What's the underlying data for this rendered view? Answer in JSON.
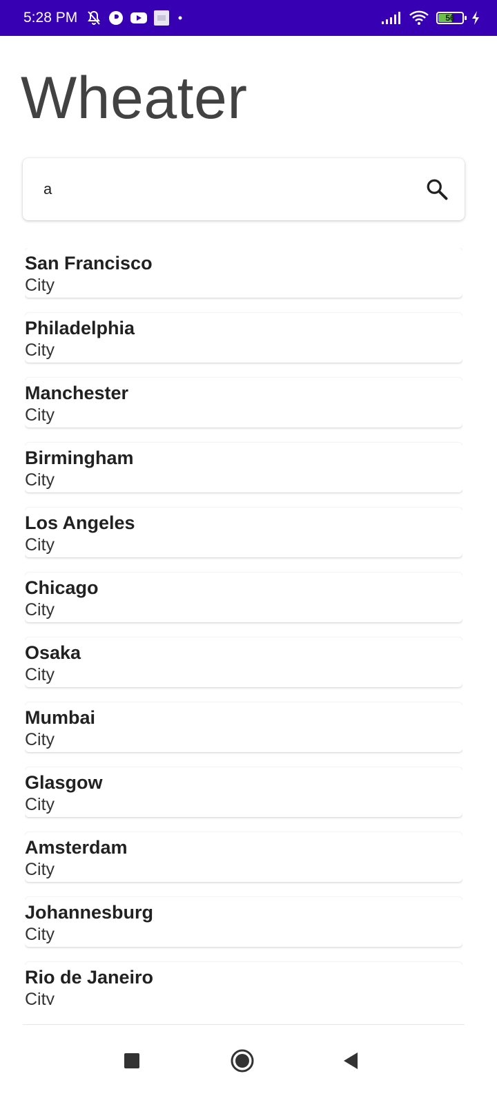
{
  "status_bar": {
    "time": "5:28 PM",
    "battery_level": "56",
    "icons": [
      "bell-off-icon",
      "app-notification-icon",
      "youtube-icon",
      "image-icon",
      "dot-icon",
      "signal-icon",
      "wifi-icon",
      "battery-icon",
      "charging-icon"
    ],
    "background": "#3700b3"
  },
  "app": {
    "title": "Wheater"
  },
  "search": {
    "value": "a",
    "icon": "search-icon"
  },
  "results": [
    {
      "name": "San Francisco",
      "type": "City"
    },
    {
      "name": "Philadelphia",
      "type": "City"
    },
    {
      "name": "Manchester",
      "type": "City"
    },
    {
      "name": "Birmingham",
      "type": "City"
    },
    {
      "name": "Los Angeles",
      "type": "City"
    },
    {
      "name": "Chicago",
      "type": "City"
    },
    {
      "name": "Osaka",
      "type": "City"
    },
    {
      "name": "Mumbai",
      "type": "City"
    },
    {
      "name": "Glasgow",
      "type": "City"
    },
    {
      "name": "Amsterdam",
      "type": "City"
    },
    {
      "name": "Johannesburg",
      "type": "City"
    },
    {
      "name": "Rio de Janeiro",
      "type": "City"
    }
  ],
  "nav_bar": {
    "buttons": [
      "recents-icon",
      "home-icon",
      "back-icon"
    ]
  }
}
